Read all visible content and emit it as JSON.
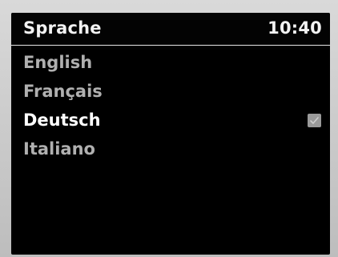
{
  "header": {
    "title": "Sprache",
    "time": "10:40"
  },
  "languages": [
    {
      "label": "English",
      "selected": false
    },
    {
      "label": "Français",
      "selected": false
    },
    {
      "label": "Deutsch",
      "selected": true
    },
    {
      "label": "Italiano",
      "selected": false
    }
  ],
  "icons": {
    "selected_marker": "checkmark-icon"
  },
  "colors": {
    "background": "#000000",
    "selected_text": "#ffffff",
    "unselected_text": "#b0b0b0",
    "checkbox": "#9a9a9a"
  }
}
